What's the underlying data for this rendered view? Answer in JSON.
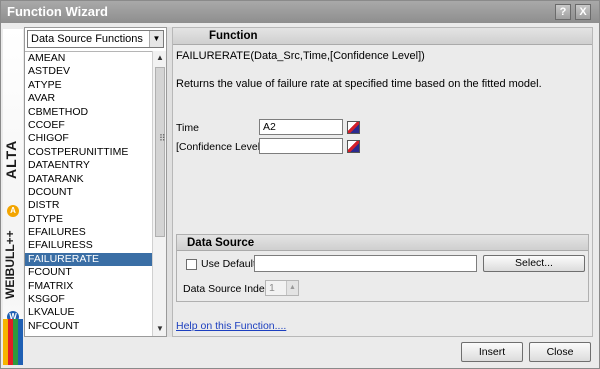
{
  "window": {
    "title": "Function Wizard",
    "help_glyph": "?",
    "close_glyph": "X"
  },
  "brand": {
    "alta": "ALTA",
    "weibull": "WEIBULL++",
    "alta_badge": "A",
    "weibull_badge": "W"
  },
  "category_select": {
    "value": "Data Source Functions"
  },
  "functions": [
    "AMEAN",
    "ASTDEV",
    "ATYPE",
    "AVAR",
    "CBMETHOD",
    "CCOEF",
    "CHIGOF",
    "COSTPERUNITTIME",
    "DATAENTRY",
    "DATARANK",
    "DCOUNT",
    "DISTR",
    "DTYPE",
    "EFAILURES",
    "EFAILURESS",
    "FAILURERATE",
    "FCOUNT",
    "FMATRIX",
    "KSGOF",
    "LKVALUE",
    "NFCOUNT"
  ],
  "selected_function": "FAILURERATE",
  "function_panel": {
    "header": "Function",
    "syntax": "FAILURERATE(Data_Src,Time,[Confidence Level])",
    "description": "Returns the value of failure rate at specified time based on the fitted model.",
    "params": [
      {
        "label": "Time",
        "value": "A2"
      },
      {
        "label": "[Confidence Level]",
        "value": ""
      }
    ]
  },
  "data_source": {
    "header": "Data Source",
    "use_default_label": "Use Default",
    "use_default_checked": false,
    "source_value": "",
    "select_label": "Select...",
    "index_label": "Data Source Index",
    "index_value": "1"
  },
  "help_link": "Help on this Function....",
  "buttons": {
    "insert": "Insert",
    "close": "Close"
  }
}
